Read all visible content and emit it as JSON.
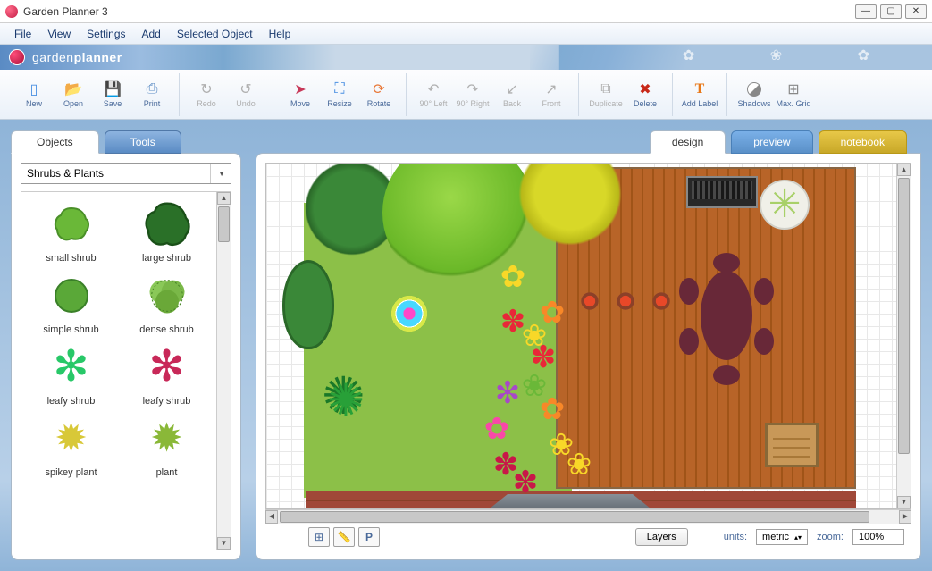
{
  "window": {
    "title": "Garden Planner 3"
  },
  "menu": {
    "items": [
      "File",
      "View",
      "Settings",
      "Add",
      "Selected Object",
      "Help"
    ]
  },
  "brand": {
    "prefix": "garden",
    "suffix": "planner"
  },
  "toolbar": {
    "new": "New",
    "open": "Open",
    "save": "Save",
    "print": "Print",
    "redo": "Redo",
    "undo": "Undo",
    "move": "Move",
    "resize": "Resize",
    "rotate": "Rotate",
    "left90": "90° Left",
    "right90": "90° Right",
    "back": "Back",
    "front": "Front",
    "duplicate": "Duplicate",
    "delete": "Delete",
    "addlabel": "Add Label",
    "shadows": "Shadows",
    "maxgrid": "Max. Grid"
  },
  "left": {
    "tab_objects": "Objects",
    "tab_tools": "Tools",
    "category": "Shrubs & Plants",
    "items": [
      {
        "label": "small shrub"
      },
      {
        "label": "large shrub"
      },
      {
        "label": "simple shrub"
      },
      {
        "label": "dense shrub"
      },
      {
        "label": "leafy shrub"
      },
      {
        "label": "leafy shrub"
      },
      {
        "label": "spikey plant"
      },
      {
        "label": "plant"
      }
    ]
  },
  "views": {
    "design": "design",
    "preview": "preview",
    "notebook": "notebook"
  },
  "status": {
    "layers": "Layers",
    "units_label": "units:",
    "units_value": "metric",
    "zoom_label": "zoom:",
    "zoom_value": "100%"
  }
}
